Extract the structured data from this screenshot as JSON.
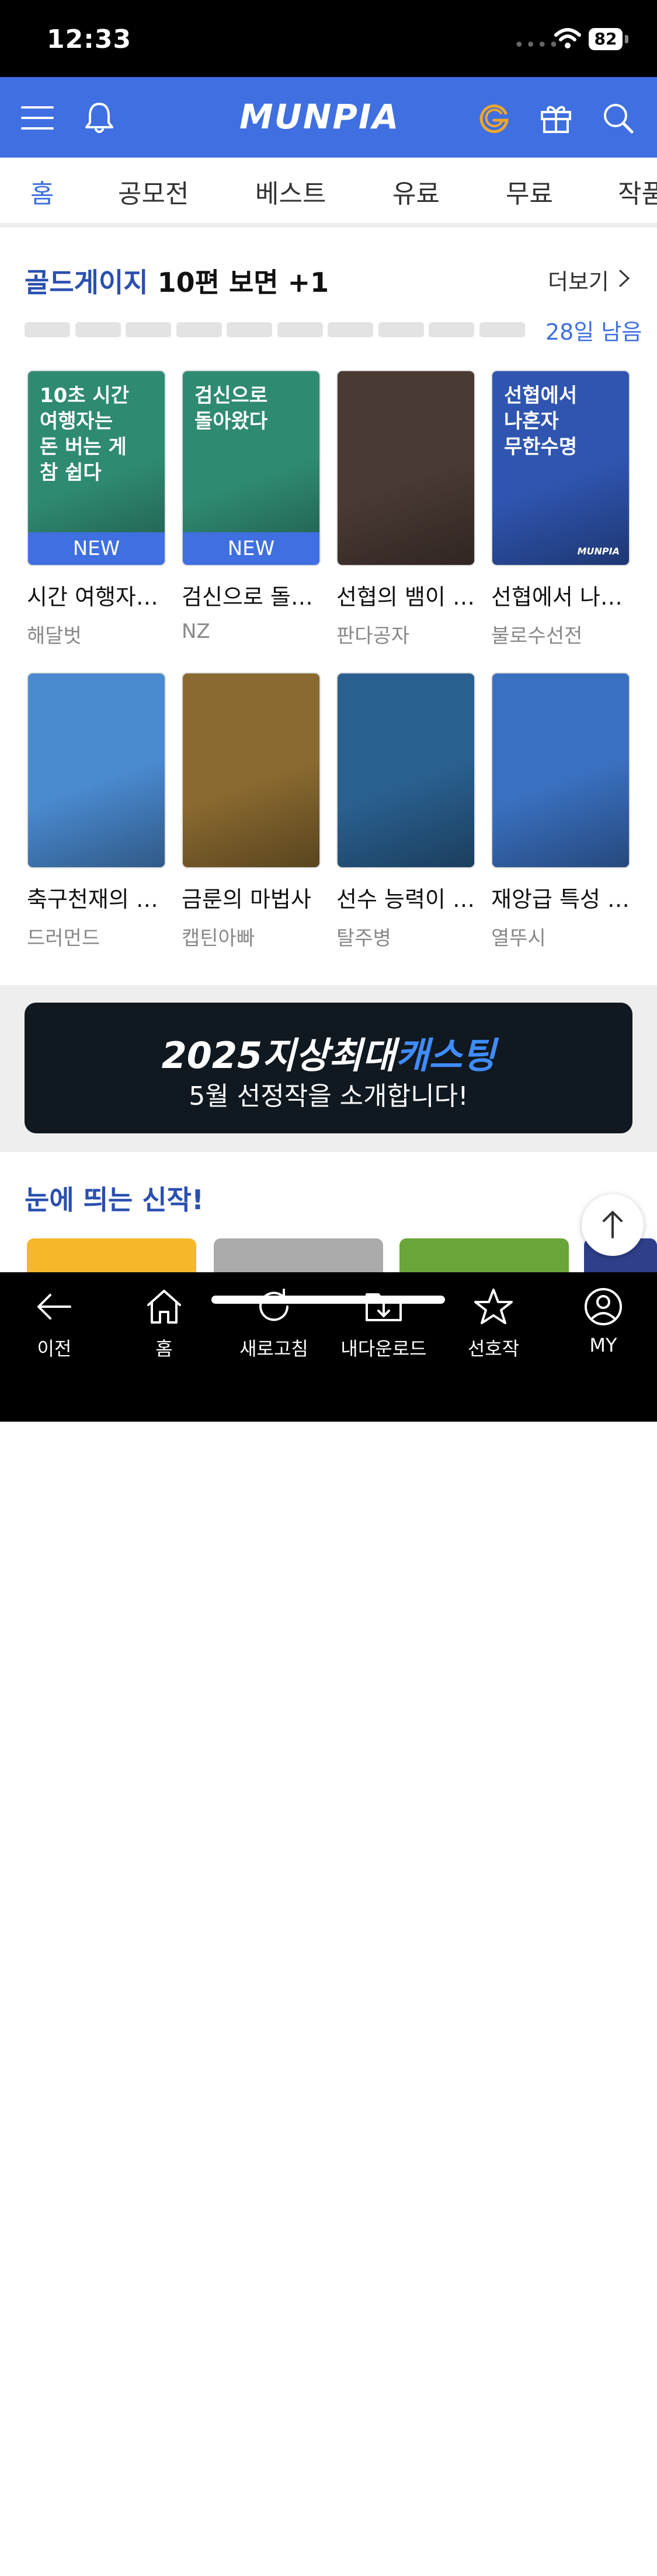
{
  "status_bar": {
    "time": "12:33",
    "battery": "82"
  },
  "header": {
    "logo": "MUNPIA"
  },
  "tabs": [
    {
      "label": "홈",
      "active": true
    },
    {
      "label": "공모전"
    },
    {
      "label": "베스트"
    },
    {
      "label": "유료"
    },
    {
      "label": "무료"
    },
    {
      "label": "작품"
    }
  ],
  "gold_gauge": {
    "title_highlight": "골드게이지",
    "title_rest": "10편 보면 +1",
    "more_label": "더보기",
    "progress_segments_total": 10,
    "progress_segments_filled": 0,
    "days_left": "28일 남음"
  },
  "books": [
    {
      "cover_text": "10초 시간\n여행자는\n돈 버는 게\n참 쉽다",
      "badge": "NEW",
      "title": "시간 여행자…",
      "author": "해달벗",
      "cover_color": "#2f8a72"
    },
    {
      "cover_text": "검신으로\n돌아왔다",
      "badge": "NEW",
      "title": "검신으로 돌…",
      "author": "NZ",
      "cover_color": "#2f8a72"
    },
    {
      "cover_text": "",
      "badge": "",
      "title": "선협의 뱀이 …",
      "author": "판다공자",
      "cover_color": "#4a3a34"
    },
    {
      "cover_text": "선협에서\n나혼자\n무한수명",
      "badge": "",
      "title": "선협에서 나…",
      "author": "불로수선전",
      "cover_color": "#2f55b0",
      "mini_logo": "MUNPIA"
    },
    {
      "cover_text": "",
      "badge": "",
      "title": "축구천재의 …",
      "author": "드러먼드",
      "cover_color": "#4a8ad0"
    },
    {
      "cover_text": "",
      "badge": "",
      "title": "금룬의 마법사",
      "author": "캡틴아빠",
      "cover_color": "#8a6a30"
    },
    {
      "cover_text": "",
      "badge": "",
      "title": "선수 능력이 …",
      "author": "탈주병",
      "cover_color": "#2a6090"
    },
    {
      "cover_text": "",
      "badge": "",
      "title": "재앙급 특성 …",
      "author": "열뚜시",
      "cover_color": "#3a70c0"
    }
  ],
  "banner": {
    "title_white": "2025지상최대",
    "title_blue": "캐스팅",
    "subtitle": "5월 선정작을 소개합니다!"
  },
  "new_section": {
    "title": "눈에 띄는 신작!"
  },
  "bottom_nav": [
    {
      "label": "이전",
      "icon": "back-arrow-icon"
    },
    {
      "label": "홈",
      "icon": "home-icon"
    },
    {
      "label": "새로고침",
      "icon": "refresh-icon"
    },
    {
      "label": "내다운로드",
      "icon": "download-folder-icon"
    },
    {
      "label": "선호작",
      "icon": "star-icon"
    },
    {
      "label": "MY",
      "icon": "user-icon"
    }
  ]
}
